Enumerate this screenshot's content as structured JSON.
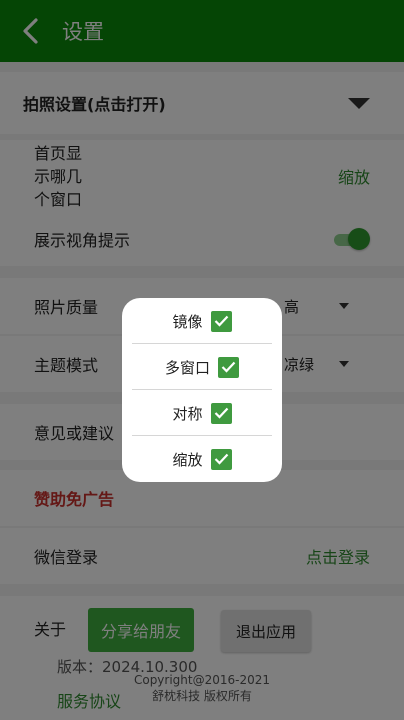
{
  "appbar": {
    "title": "设置"
  },
  "camera": {
    "label": "拍照设置(点击打开)"
  },
  "home_window": {
    "label_lines": [
      "首页显",
      "示哪几",
      "个窗口"
    ],
    "value": "缩放"
  },
  "view_angle": {
    "label": "展示视角提示",
    "enabled": true
  },
  "photo_quality": {
    "label": "照片质量",
    "value": "高"
  },
  "theme": {
    "label": "主题模式",
    "value": "凉绿"
  },
  "feedback": {
    "label": "意见或建议"
  },
  "sponsor": {
    "label": "赞助免广告"
  },
  "wechat": {
    "label": "微信登录",
    "action": "点击登录"
  },
  "about": {
    "label": "关于",
    "share_button": "分享给朋友",
    "quit_button": "退出应用",
    "version": "版本：2024.10.300",
    "copyright_line1": "Copyright@2016-2021",
    "copyright_line2": "舒枕科技 版权所有",
    "terms": "服务协议"
  },
  "dialog": {
    "options": [
      {
        "label": "镜像",
        "checked": true
      },
      {
        "label": "多窗口",
        "checked": true
      },
      {
        "label": "对称",
        "checked": true
      },
      {
        "label": "缩放",
        "checked": true
      }
    ]
  },
  "colors": {
    "appbar": "#0a8a0a",
    "accent": "#2f8a2f",
    "sponsor": "#c9302c"
  }
}
